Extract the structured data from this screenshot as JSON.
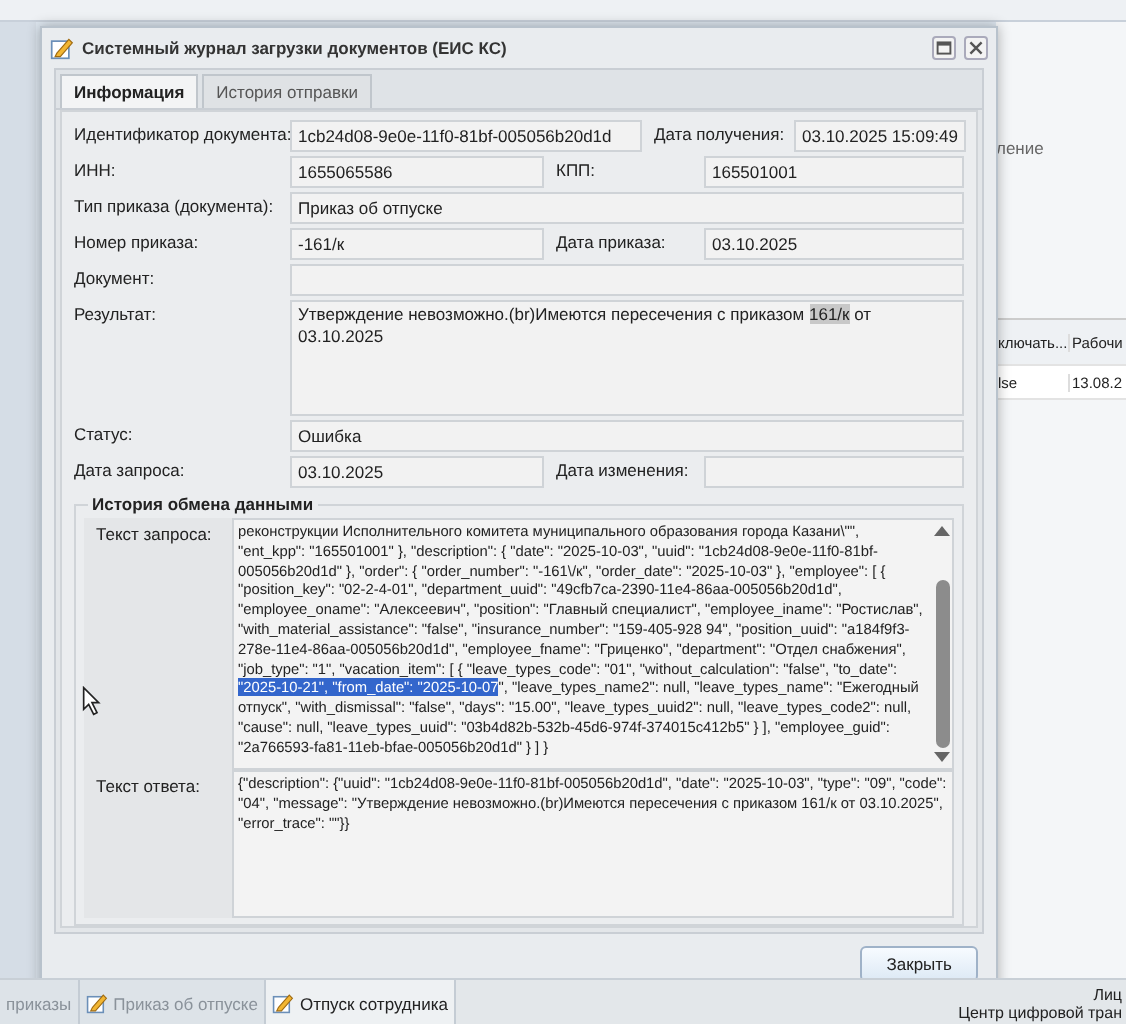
{
  "app_background": {
    "side_items": [
      "ление"
    ],
    "table": {
      "columns": [
        "ключать...",
        "Рабочи"
      ],
      "rows": [
        [
          "lse",
          "13.08.2"
        ]
      ]
    }
  },
  "dialog": {
    "title": "Системный журнал загрузки документов (ЕИС КС)",
    "tabs": [
      {
        "label": "Информация",
        "selected": true
      },
      {
        "label": "История отправки",
        "selected": false
      }
    ],
    "rows": [
      [
        {
          "kind": "text",
          "label": "Идентификатор документа:",
          "value": "1cb24d08-9e0e-11f0-81bf-005056b20d1d"
        },
        {
          "kind": "text",
          "label": "Дата получения:",
          "value": "03.10.2025 15:09:49"
        }
      ],
      [
        {
          "kind": "text",
          "label": "ИНН:",
          "value": "1655065586"
        },
        {
          "kind": "text",
          "label": "КПП:",
          "value": "165501001"
        }
      ],
      [
        {
          "kind": "text",
          "label": "Тип приказа (документа):",
          "value": "Приказ об отпуске"
        }
      ],
      [
        {
          "kind": "text",
          "label": "Номер приказа:",
          "value": "-161/к"
        },
        {
          "kind": "text",
          "label": "Дата приказа:",
          "value": "03.10.2025"
        }
      ],
      [
        {
          "kind": "text",
          "label": "Документ:"
        }
      ],
      [
        {
          "kind": "textarea",
          "label": "Результат:",
          "segments": [
            {
              "text": "Утверждение невозможно.(br)Имеются пересечения с приказом ",
              "selected": false
            },
            {
              "text": "161/к",
              "selected": true
            },
            {
              "text": " от 03.10.2025",
              "selected": false
            }
          ]
        }
      ],
      [
        {
          "kind": "text",
          "label": "Статус:",
          "value": "Ошибка"
        }
      ],
      [
        {
          "kind": "text",
          "label": "Дата запроса:",
          "value": "03.10.2025"
        },
        {
          "kind": "text",
          "label": "Дата изменения:"
        }
      ]
    ],
    "history": {
      "title": "История обмена данными",
      "request": {
        "label": "Текст запроса:",
        "segments": [
          {
            "text": "реконструкции Исполнительного комитета муниципального образования города Казани\\\"\", \"ent_kpp\": \"165501001\" }, \"description\": { \"date\": \"2025-10-03\", \"uuid\": \"1cb24d08-9e0e-11f0-81bf-005056b20d1d\" }, \"order\": { \"order_number\": \"-161\\/к\", \"order_date\": \"2025-10-03\" }, \"employee\": [ { \"position_key\": \"02-2-4-01\", \"department_uuid\": \"49cfb7ca-2390-11e4-86aa-005056b20d1d\", \"employee_oname\": \"Алексеевич\", \"position\": \"Главный специалист\", \"employee_iname\": \"Ростислав\", \"with_material_assistance\": \"false\", \"insurance_number\": \"159-405-928 94\", \"position_uuid\": \"a184f9f3-278e-11e4-86aa-005056b20d1d\", \"employee_fname\": \"Гриценко\", \"department\": \"Отдел снабжения\", \"job_type\": \"1\", \"vacation_item\": [ { \"leave_types_code\": \"01\", \"without_calculation\": \"false\", \"to_date\": ",
            "selected": false
          },
          {
            "text": "\"2025-10-21\", \"from_date\": \"2025-10-07",
            "selected": true
          },
          {
            "text": "\", \"leave_types_name2\": null, \"leave_types_name\": \"Ежегодный отпуск\", \"with_dismissal\": \"false\", \"days\": \"15.00\", \"leave_types_uuid2\": null, \"leave_types_code2\": null, \"cause\": null, \"leave_types_uuid\": \"03b4d82b-532b-45d6-974f-374015c412b5\" } ], \"employee_guid\": \"2a766593-fa81-11eb-bfae-005056b20d1d\" } ] }",
            "selected": false
          }
        ]
      },
      "response": {
        "label": "Текст ответа:",
        "text": "{\"description\": {\"uuid\": \"1cb24d08-9e0e-11f0-81bf-005056b20d1d\", \"date\": \"2025-10-03\", \"type\": \"09\", \"code\": \"04\", \"message\": \"Утверждение невозможно.(br)Имеются пересечения с приказом 161/к от 03.10.2025\", \"error_trace\": \"\"}}"
      }
    },
    "buttons": [
      "Закрыть"
    ]
  },
  "taskbar": {
    "tabs": [
      {
        "label": "приказы",
        "selected": false
      },
      {
        "label": "Приказ об отпуске",
        "selected": false
      },
      {
        "label": "Отпуск сотрудника",
        "selected": true
      }
    ],
    "status": [
      "Лиц",
      "Центр цифровой тран"
    ]
  }
}
